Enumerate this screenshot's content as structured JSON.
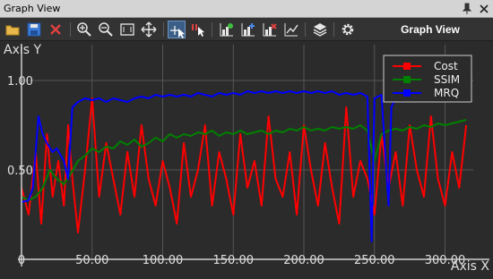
{
  "window": {
    "title": "Graph View",
    "toolbar_title": "Graph View"
  },
  "toolbar": {
    "buttons": [
      "open-folder-icon",
      "save-icon",
      "close-x-icon",
      "zoom-in-icon",
      "zoom-out-icon",
      "fit-view-icon",
      "pan-move-icon",
      "select-cursor-icon",
      "magnet-cursor-icon",
      "bar-chart-add-icon",
      "bar-chart-plus-icon",
      "bar-chart-remove-icon",
      "line-chart-icon",
      "layers-icon",
      "settings-gear-icon"
    ],
    "selected": "select-cursor-icon"
  },
  "colors": {
    "background": "#2b2b2b",
    "grid": "#555555",
    "axis": "#d0d0d0",
    "cost": "#ff0000",
    "ssim": "#008000",
    "mrq": "#0000ff"
  },
  "chart_data": {
    "type": "line",
    "xlabel": "Axis X",
    "ylabel": "Axis Y",
    "xlim": [
      0,
      320
    ],
    "ylim": [
      0.0,
      1.2
    ],
    "x_ticks": [
      0,
      50,
      100,
      150,
      200,
      250,
      300
    ],
    "x_tick_labels": [
      "0",
      "50.00",
      "100.00",
      "150.00",
      "200.00",
      "250.00",
      "300.00"
    ],
    "y_ticks": [
      0.5,
      1.0
    ],
    "y_tick_labels": [
      "0.50",
      "1.00"
    ],
    "grid": true,
    "legend_position": "top-right",
    "series": [
      {
        "name": "Cost",
        "color": "#ff0000",
        "points": [
          [
            0,
            0.4
          ],
          [
            5,
            0.25
          ],
          [
            10,
            0.6
          ],
          [
            14,
            0.2
          ],
          [
            18,
            0.7
          ],
          [
            22,
            0.35
          ],
          [
            26,
            0.55
          ],
          [
            30,
            0.3
          ],
          [
            33,
            0.75
          ],
          [
            36,
            0.45
          ],
          [
            40,
            0.15
          ],
          [
            45,
            0.5
          ],
          [
            50,
            0.9
          ],
          [
            55,
            0.35
          ],
          [
            60,
            0.65
          ],
          [
            65,
            0.45
          ],
          [
            70,
            0.25
          ],
          [
            75,
            0.6
          ],
          [
            80,
            0.35
          ],
          [
            85,
            0.75
          ],
          [
            90,
            0.45
          ],
          [
            95,
            0.3
          ],
          [
            100,
            0.55
          ],
          [
            105,
            0.4
          ],
          [
            110,
            0.2
          ],
          [
            115,
            0.65
          ],
          [
            120,
            0.35
          ],
          [
            125,
            0.5
          ],
          [
            130,
            0.75
          ],
          [
            135,
            0.3
          ],
          [
            140,
            0.6
          ],
          [
            145,
            0.45
          ],
          [
            150,
            0.25
          ],
          [
            155,
            0.7
          ],
          [
            160,
            0.4
          ],
          [
            165,
            0.55
          ],
          [
            170,
            0.3
          ],
          [
            175,
            0.8
          ],
          [
            180,
            0.45
          ],
          [
            185,
            0.35
          ],
          [
            190,
            0.6
          ],
          [
            195,
            0.25
          ],
          [
            200,
            0.75
          ],
          [
            205,
            0.5
          ],
          [
            210,
            0.3
          ],
          [
            215,
            0.65
          ],
          [
            220,
            0.4
          ],
          [
            225,
            0.2
          ],
          [
            230,
            0.85
          ],
          [
            235,
            0.35
          ],
          [
            240,
            0.55
          ],
          [
            245,
            0.45
          ],
          [
            250,
            0.25
          ],
          [
            255,
            0.7
          ],
          [
            260,
            0.4
          ],
          [
            265,
            0.6
          ],
          [
            270,
            0.3
          ],
          [
            275,
            0.75
          ],
          [
            280,
            0.5
          ],
          [
            285,
            0.35
          ],
          [
            290,
            0.8
          ],
          [
            295,
            0.45
          ],
          [
            300,
            0.3
          ],
          [
            305,
            0.6
          ],
          [
            310,
            0.4
          ],
          [
            315,
            0.75
          ]
        ]
      },
      {
        "name": "SSIM",
        "color": "#008000",
        "points": [
          [
            0,
            0.35
          ],
          [
            5,
            0.33
          ],
          [
            10,
            0.35
          ],
          [
            15,
            0.4
          ],
          [
            20,
            0.5
          ],
          [
            25,
            0.45
          ],
          [
            30,
            0.42
          ],
          [
            35,
            0.48
          ],
          [
            40,
            0.55
          ],
          [
            45,
            0.58
          ],
          [
            50,
            0.62
          ],
          [
            55,
            0.6
          ],
          [
            60,
            0.63
          ],
          [
            65,
            0.62
          ],
          [
            70,
            0.66
          ],
          [
            75,
            0.64
          ],
          [
            80,
            0.67
          ],
          [
            85,
            0.63
          ],
          [
            90,
            0.65
          ],
          [
            95,
            0.68
          ],
          [
            100,
            0.66
          ],
          [
            105,
            0.7
          ],
          [
            110,
            0.68
          ],
          [
            115,
            0.7
          ],
          [
            120,
            0.69
          ],
          [
            125,
            0.71
          ],
          [
            130,
            0.7
          ],
          [
            135,
            0.72
          ],
          [
            140,
            0.69
          ],
          [
            145,
            0.71
          ],
          [
            150,
            0.7
          ],
          [
            155,
            0.72
          ],
          [
            160,
            0.7
          ],
          [
            165,
            0.71
          ],
          [
            170,
            0.72
          ],
          [
            175,
            0.7
          ],
          [
            180,
            0.72
          ],
          [
            185,
            0.71
          ],
          [
            190,
            0.73
          ],
          [
            195,
            0.72
          ],
          [
            200,
            0.74
          ],
          [
            205,
            0.72
          ],
          [
            210,
            0.73
          ],
          [
            215,
            0.72
          ],
          [
            220,
            0.74
          ],
          [
            225,
            0.73
          ],
          [
            230,
            0.74
          ],
          [
            235,
            0.73
          ],
          [
            240,
            0.75
          ],
          [
            245,
            0.72
          ],
          [
            250,
            0.55
          ],
          [
            255,
            0.7
          ],
          [
            260,
            0.72
          ],
          [
            265,
            0.73
          ],
          [
            270,
            0.72
          ],
          [
            275,
            0.74
          ],
          [
            280,
            0.73
          ],
          [
            285,
            0.75
          ],
          [
            290,
            0.74
          ],
          [
            295,
            0.76
          ],
          [
            300,
            0.75
          ],
          [
            305,
            0.76
          ],
          [
            310,
            0.77
          ],
          [
            315,
            0.78
          ]
        ]
      },
      {
        "name": "MRQ",
        "color": "#0000ff",
        "points": [
          [
            0,
            0.32
          ],
          [
            5,
            0.33
          ],
          [
            8,
            0.4
          ],
          [
            12,
            0.8
          ],
          [
            15,
            0.7
          ],
          [
            18,
            0.65
          ],
          [
            22,
            0.6
          ],
          [
            25,
            0.62
          ],
          [
            30,
            0.55
          ],
          [
            33,
            0.45
          ],
          [
            36,
            0.85
          ],
          [
            40,
            0.88
          ],
          [
            45,
            0.9
          ],
          [
            50,
            0.89
          ],
          [
            55,
            0.9
          ],
          [
            60,
            0.88
          ],
          [
            65,
            0.9
          ],
          [
            70,
            0.89
          ],
          [
            75,
            0.88
          ],
          [
            80,
            0.9
          ],
          [
            85,
            0.91
          ],
          [
            90,
            0.9
          ],
          [
            95,
            0.92
          ],
          [
            100,
            0.91
          ],
          [
            105,
            0.92
          ],
          [
            110,
            0.91
          ],
          [
            115,
            0.92
          ],
          [
            120,
            0.91
          ],
          [
            125,
            0.93
          ],
          [
            130,
            0.92
          ],
          [
            135,
            0.91
          ],
          [
            140,
            0.93
          ],
          [
            145,
            0.92
          ],
          [
            150,
            0.93
          ],
          [
            155,
            0.92
          ],
          [
            160,
            0.94
          ],
          [
            165,
            0.93
          ],
          [
            170,
            0.94
          ],
          [
            175,
            0.93
          ],
          [
            180,
            0.94
          ],
          [
            185,
            0.93
          ],
          [
            190,
            0.94
          ],
          [
            195,
            0.93
          ],
          [
            200,
            0.94
          ],
          [
            205,
            0.93
          ],
          [
            210,
            0.94
          ],
          [
            215,
            0.93
          ],
          [
            220,
            0.94
          ],
          [
            225,
            0.92
          ],
          [
            230,
            0.93
          ],
          [
            235,
            0.92
          ],
          [
            240,
            0.93
          ],
          [
            245,
            0.91
          ],
          [
            248,
            0.1
          ],
          [
            250,
            0.9
          ],
          [
            255,
            0.92
          ],
          [
            260,
            0.3
          ],
          [
            262,
            0.85
          ],
          [
            265,
            0.9
          ],
          [
            270,
            0.88
          ],
          [
            275,
            0.91
          ],
          [
            280,
            0.92
          ],
          [
            285,
            0.9
          ],
          [
            290,
            0.93
          ],
          [
            295,
            0.92
          ],
          [
            300,
            0.94
          ],
          [
            305,
            0.93
          ],
          [
            310,
            0.92
          ],
          [
            315,
            0.9
          ]
        ]
      }
    ]
  }
}
